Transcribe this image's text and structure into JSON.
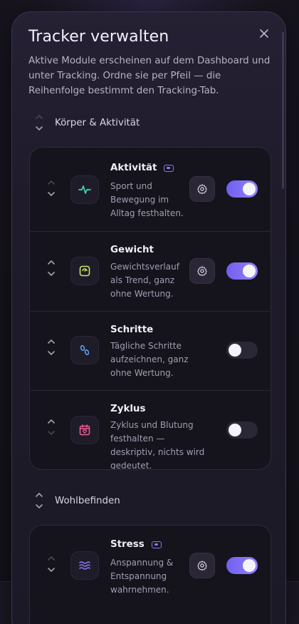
{
  "dialog": {
    "title": "Tracker verwalten",
    "description": "Aktive Module erscheinen auf dem Dashboard und unter Tracking. Ordne sie per Pfeil — die Reihenfolge bestimmt den Tracking-Tab.",
    "close_icon": "close-icon"
  },
  "sections": [
    {
      "title": "Körper & Aktivität",
      "items": [
        {
          "name": "Aktivität",
          "description": "Sport und Bewegung im Alltag festhalten.",
          "icon": "activity-pulse-icon",
          "icon_color": "#3dd6b5",
          "badge": true,
          "settings": true,
          "enabled": true
        },
        {
          "name": "Gewicht",
          "description": "Gewichtsverlauf als Trend, ganz ohne Wertung.",
          "icon": "scale-icon",
          "icon_color": "#c8e66a",
          "badge": false,
          "settings": true,
          "enabled": true
        },
        {
          "name": "Schritte",
          "description": "Tägliche Schritte aufzeichnen, ganz ohne Wertung.",
          "icon": "footsteps-icon",
          "icon_color": "#5aa8f5",
          "badge": false,
          "settings": false,
          "enabled": false
        },
        {
          "name": "Zyklus",
          "description": "Zyklus und Blutung festhalten — deskriptiv, nichts wird gedeutet.",
          "icon": "calendar-heart-icon",
          "icon_color": "#ee5f97",
          "badge": false,
          "settings": false,
          "enabled": false
        }
      ]
    },
    {
      "title": "Wohlbefinden",
      "items": [
        {
          "name": "Stress",
          "description": "Anspannung & Entspannung wahrnehmen.",
          "icon": "waves-icon",
          "icon_color": "#8a78f5",
          "badge": true,
          "settings": true,
          "enabled": true
        }
      ]
    }
  ],
  "colors": {
    "accent": "#7b6bf3",
    "toggle_off": "#2b2835",
    "card_bg": "#15131c"
  }
}
